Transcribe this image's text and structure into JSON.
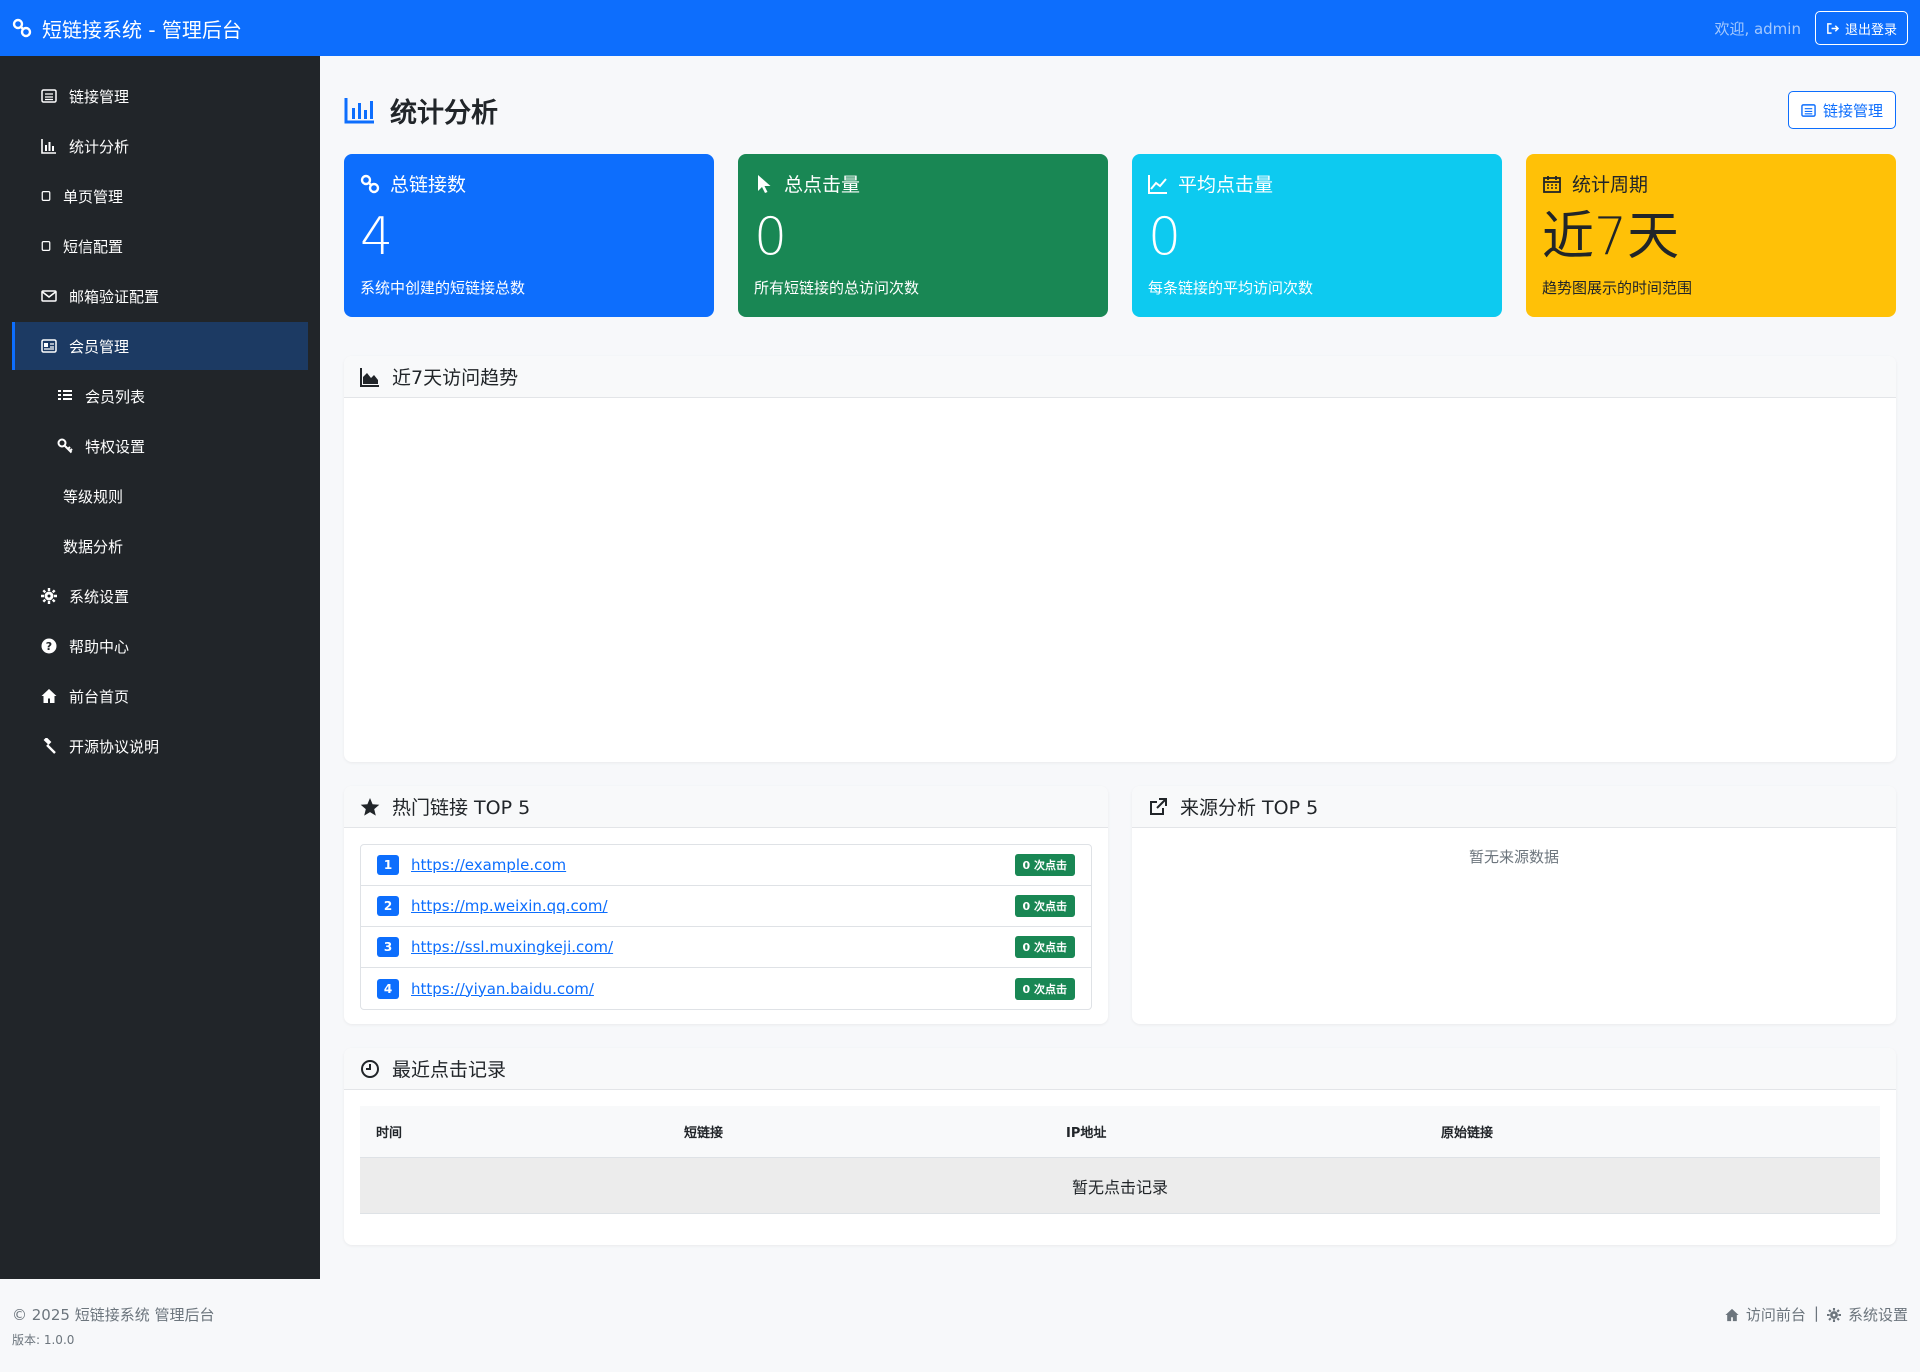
{
  "header": {
    "brand": "短链接系统 - 管理后台",
    "welcome": "欢迎, admin",
    "logout_label": "退出登录"
  },
  "sidebar": {
    "items": [
      {
        "label": "链接管理"
      },
      {
        "label": "统计分析"
      },
      {
        "label": "单页管理"
      },
      {
        "label": "短信配置"
      },
      {
        "label": "邮箱验证配置"
      },
      {
        "label": "会员管理"
      },
      {
        "label": "会员列表"
      },
      {
        "label": "特权设置"
      },
      {
        "label": "等级规则"
      },
      {
        "label": "数据分析"
      },
      {
        "label": "系统设置"
      },
      {
        "label": "帮助中心"
      },
      {
        "label": "前台首页"
      },
      {
        "label": "开源协议说明"
      }
    ]
  },
  "page": {
    "title": "统计分析",
    "link_manage_button": "链接管理"
  },
  "stats": [
    {
      "title": "总链接数",
      "value": "4",
      "desc": "系统中创建的短链接总数"
    },
    {
      "title": "总点击量",
      "value": "0",
      "desc": "所有短链接的总访问次数"
    },
    {
      "title": "平均点击量",
      "value": "0",
      "desc": "每条链接的平均访问次数"
    },
    {
      "title": "统计周期",
      "value": "近7天",
      "desc": "趋势图展示的时间范围"
    }
  ],
  "trend": {
    "title": "近7天访问趋势"
  },
  "hot_links": {
    "title": "热门链接 TOP 5",
    "items": [
      {
        "rank": "1",
        "url": "https://example.com",
        "clicks": "0 次点击"
      },
      {
        "rank": "2",
        "url": "https://mp.weixin.qq.com/",
        "clicks": "0 次点击"
      },
      {
        "rank": "3",
        "url": "https://ssl.muxingkeji.com/",
        "clicks": "0 次点击"
      },
      {
        "rank": "4",
        "url": "https://yiyan.baidu.com/",
        "clicks": "0 次点击"
      }
    ]
  },
  "sources": {
    "title": "来源分析 TOP 5",
    "empty": "暂无来源数据"
  },
  "recent": {
    "title": "最近点击记录",
    "columns": [
      "时间",
      "短链接",
      "IP地址",
      "原始链接"
    ],
    "empty": "暂无点击记录"
  },
  "footer": {
    "copyright": "© 2025 短链接系统 管理后台",
    "version": "版本: 1.0.0",
    "visit_front": "访问前台",
    "separator": "|",
    "system_settings": "系统设置"
  },
  "colors": {
    "primary": "#0d6efd",
    "success": "#198754",
    "info": "#0dcaf0",
    "warning": "#ffc107",
    "sidebar": "#212529"
  }
}
